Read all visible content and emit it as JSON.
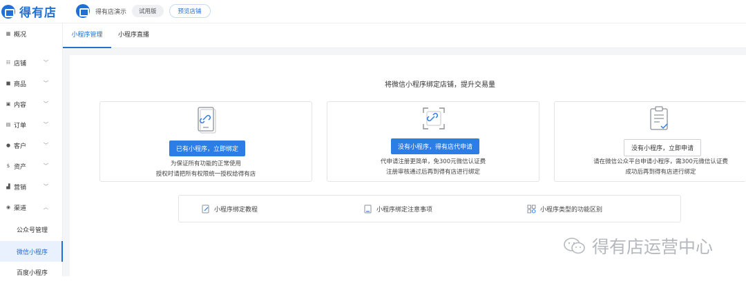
{
  "header": {
    "brand": "得有店",
    "store_name": "得有店演示",
    "trial_badge": "试用版",
    "preview_button": "预览店铺"
  },
  "sidebar": {
    "items": [
      {
        "icon": "grid-icon",
        "label": "概况"
      },
      {
        "icon": "store-icon",
        "label": "店铺"
      },
      {
        "icon": "goods-icon",
        "label": "商品"
      },
      {
        "icon": "content-icon",
        "label": "内容"
      },
      {
        "icon": "order-icon",
        "label": "订单"
      },
      {
        "icon": "customer-icon",
        "label": "客户"
      },
      {
        "icon": "asset-icon",
        "label": "资产"
      },
      {
        "icon": "marketing-icon",
        "label": "营销"
      },
      {
        "icon": "channel-icon",
        "label": "渠道"
      }
    ],
    "sub_items": [
      {
        "label": "公众号管理"
      },
      {
        "label": "微信小程序"
      },
      {
        "label": "百度小程序"
      }
    ]
  },
  "tabs": [
    {
      "label": "小程序管理"
    },
    {
      "label": "小程序直播"
    }
  ],
  "main": {
    "title": "将微信小程序绑定店铺，提升交易量",
    "cards": [
      {
        "icon": "link-phone-icon",
        "button": "已有小程序，立即绑定",
        "desc": [
          "为保证所有功能的正常使用",
          "授权时请把所有权限统一授权给得有店"
        ]
      },
      {
        "icon": "scan-link-icon",
        "button": "没有小程序，得有店代申请",
        "desc": [
          "代申请注册更简单，免300元微信认证费",
          "注册审核通过后再到得有店进行绑定"
        ]
      },
      {
        "icon": "clipboard-check-icon",
        "button": "没有小程序，立即申请",
        "desc": [
          "请在微信公众平台申请小程序，需300元微信认证费",
          "成功后再到得有店进行绑定"
        ]
      }
    ],
    "help_links": [
      {
        "icon": "edit-doc-icon",
        "label": "小程序绑定教程"
      },
      {
        "icon": "doc-icon",
        "label": "小程序绑定注意事项"
      },
      {
        "icon": "apps-icon",
        "label": "小程序类型的功能区别"
      }
    ]
  },
  "watermark": "得有店运营中心",
  "colors": {
    "accent": "#2d7de6",
    "brand": "#1f6fd6",
    "active_bg": "#e8f1fd"
  }
}
